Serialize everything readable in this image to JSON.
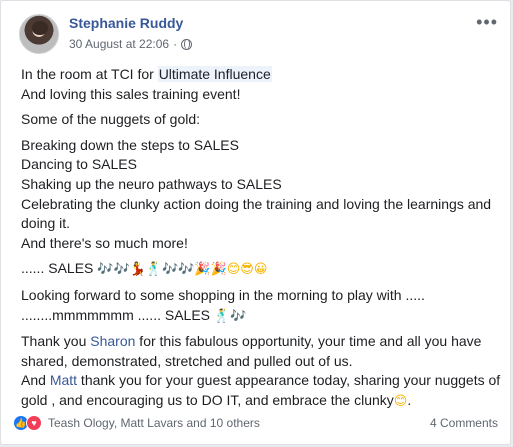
{
  "post": {
    "author": "Stephanie Ruddy",
    "timestamp": "30 August at 22:06",
    "separator": "·",
    "more": "•••",
    "line1_prefix": "In the room at TCI for ",
    "line1_link": "Ultimate Influence",
    "line2": "And loving this sales training event!",
    "nuggets_intro": "Some of the nuggets of gold:",
    "nuggets": [
      "Breaking down the steps to SALES",
      "Dancing to SALES",
      "Shaking up the neuro pathways to SALES",
      "Celebrating the clunky action doing the training and loving the learnings and doing it.",
      "And there's so much more!"
    ],
    "sales_line": "...... SALES",
    "sales_emojis": "🎶🎶💃🕺🎶🎶🎉🎉😊😎😀",
    "shopping_line1": "Looking forward to some shopping in the morning to play with .....",
    "shopping_line2": "........mmmmmmm ...... SALES",
    "shopping_emojis": "🕺🎶",
    "thanks_prefix": "Thank you ",
    "thanks_name": "Sharon",
    "thanks_rest": " for this fabulous opportunity, your time and all you have shared, demonstrated, stretched and pulled out of us.",
    "and_prefix": "And ",
    "and_name": "Matt",
    "and_rest": " thank you for your guest appearance today, sharing your nuggets of gold , and encouraging us to DO IT, and embrace the clunky",
    "and_emoji": "😊",
    "and_end": "."
  },
  "footer": {
    "like_icon": "👍",
    "love_icon": "♥",
    "reactors": "Teash Ology, Matt Lavars and 10 others",
    "comments": "4 Comments"
  },
  "icons": {
    "avatar": "user-avatar",
    "globe": "globe-icon",
    "more": "more-options-icon"
  }
}
